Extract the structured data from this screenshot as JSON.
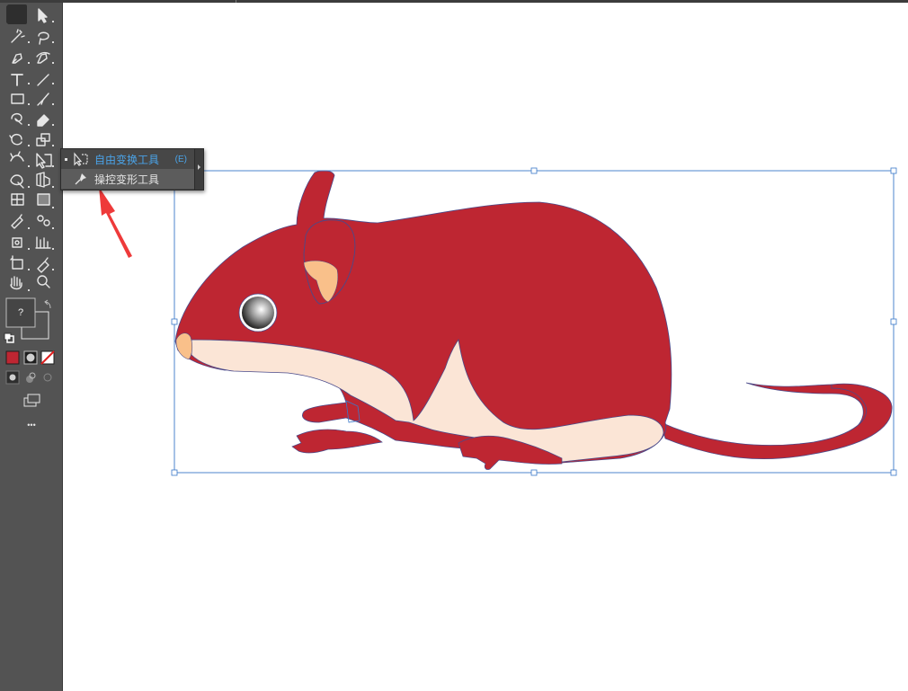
{
  "toolbar": {
    "tools": [
      {
        "name": "selection-tool-icon",
        "active": true
      },
      {
        "name": "direct-selection-tool-icon"
      },
      {
        "name": "magic-wand-tool-icon"
      },
      {
        "name": "lasso-tool-icon"
      },
      {
        "name": "pen-tool-icon"
      },
      {
        "name": "curvature-tool-icon"
      },
      {
        "name": "type-tool-icon"
      },
      {
        "name": "line-segment-tool-icon"
      },
      {
        "name": "rectangle-tool-icon"
      },
      {
        "name": "paintbrush-tool-icon"
      },
      {
        "name": "shaper-tool-icon"
      },
      {
        "name": "eraser-tool-icon"
      },
      {
        "name": "rotate-tool-icon"
      },
      {
        "name": "scale-tool-icon"
      },
      {
        "name": "width-tool-icon"
      },
      {
        "name": "free-transform-tool-icon"
      },
      {
        "name": "shape-builder-tool-icon"
      },
      {
        "name": "perspective-grid-tool-icon"
      },
      {
        "name": "mesh-tool-icon"
      },
      {
        "name": "gradient-tool-icon"
      },
      {
        "name": "eyedropper-tool-icon"
      },
      {
        "name": "blend-tool-icon"
      },
      {
        "name": "symbol-sprayer-tool-icon"
      },
      {
        "name": "column-graph-tool-icon"
      },
      {
        "name": "artboard-tool-icon"
      },
      {
        "name": "slice-tool-icon"
      },
      {
        "name": "hand-tool-icon"
      },
      {
        "name": "zoom-tool-icon"
      }
    ],
    "fill_stroke_label": "?",
    "more_label": "•••"
  },
  "flyout": {
    "items": [
      {
        "label": "自由变换工具",
        "shortcut": "(E)",
        "selected": true,
        "icon": "free-transform-icon"
      },
      {
        "label": "操控变形工具",
        "shortcut": "",
        "selected": false,
        "icon": "puppet-warp-icon"
      }
    ]
  },
  "colors": {
    "toolbar_bg": "#535353",
    "mouse_body": "#be2632",
    "mouse_belly": "#fbe5d6",
    "mouse_ear": "#f9c08a",
    "selection": "#3a78c9",
    "arrow": "#ee3a3a",
    "accent": "#4aa3e8"
  }
}
